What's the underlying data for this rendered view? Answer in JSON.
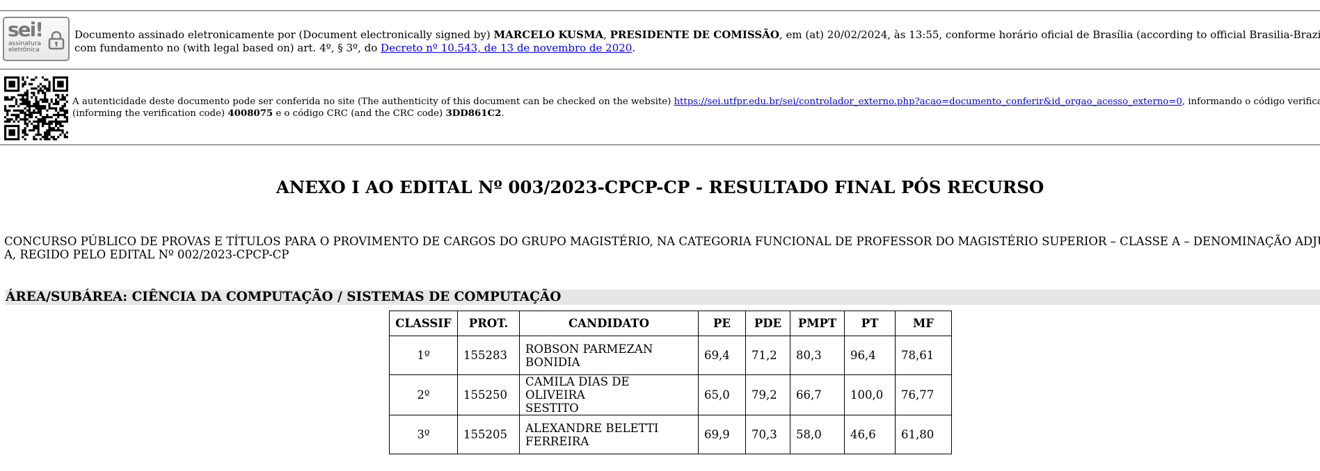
{
  "signature": {
    "logo": {
      "brand": "sei!",
      "line1": "assinatura",
      "line2": "eletrônica"
    },
    "prefix": "Documento assinado eletronicamente por (Document electronically signed by) ",
    "signer_name": "MARCELO KUSMA",
    "sep": ", ",
    "signer_role": "PRESIDENTE DE COMISSÃO",
    "middle": ", em (at) 20/02/2024, às 13:55, conforme horário oficial de Brasília (according to official Brasilia-Brazil time), com fundamento no",
    "line2_prefix": "com fundamento no (with legal based on) art. 4º, § 3º, do ",
    "decree_link": "Decreto nº 10.543, de 13 de novembro de 2020",
    "line2_suffix": "."
  },
  "verification": {
    "line1_prefix": "A autenticidade deste documento pode ser conferida no site (The authenticity of this document can be checked on the website) ",
    "url": "https://sei.utfpr.edu.br/sei/controlador_externo.php?acao=documento_conferir&id_orgao_acesso_externo=0",
    "line1_suffix": ", informando o código verificador",
    "line2_prefix": "(informing the verification code) ",
    "code": "4008075",
    "line2_mid": " e o código CRC (and the CRC code) ",
    "crc": "3DD861C2",
    "line2_suffix": "."
  },
  "title": "ANEXO I AO EDITAL Nº 003/2023-CPCP-CP - RESULTADO FINAL PÓS RECURSO",
  "description_line1": "CONCURSO PÚBLICO DE PROVAS E TÍTULOS PARA O PROVIMENTO DE CARGOS DO GRUPO MAGISTÉRIO, NA CATEGORIA FUNCIONAL DE PROFESSOR DO MAGISTÉRIO SUPERIOR – CLASSE A – DENOMINAÇÃO ADJUNTO",
  "description_line2": "A, REGIDO PELO EDITAL Nº 002/2023-CPCP-CP",
  "area": "ÁREA/SUBÁREA: CIÊNCIA DA COMPUTAÇÃO / SISTEMAS DE COMPUTAÇÃO",
  "table": {
    "headers": [
      "CLASSIF",
      "PROT.",
      "CANDIDATO",
      "PE",
      "PDE",
      "PMPT",
      "PT",
      "MF"
    ],
    "rows": [
      {
        "classif": "1º",
        "prot": "155283",
        "name1": "ROBSON PARMEZAN",
        "name2": "BONIDIA",
        "pe": "69,4",
        "pde": "71,2",
        "pmpt": "80,3",
        "pt": "96,4",
        "mf": "78,61"
      },
      {
        "classif": "2º",
        "prot": "155250",
        "name1": "CAMILA DIAS DE OLIVEIRA",
        "name2": "SESTITO",
        "pe": "65,0",
        "pde": "79,2",
        "pmpt": "66,7",
        "pt": "100,0",
        "mf": "76,77"
      },
      {
        "classif": "3º",
        "prot": "155205",
        "name1": "ALEXANDRE BELETTI",
        "name2": "FERREIRA",
        "pe": "69,9",
        "pde": "70,3",
        "pmpt": "58,0",
        "pt": "46,6",
        "mf": "61,80"
      }
    ]
  }
}
